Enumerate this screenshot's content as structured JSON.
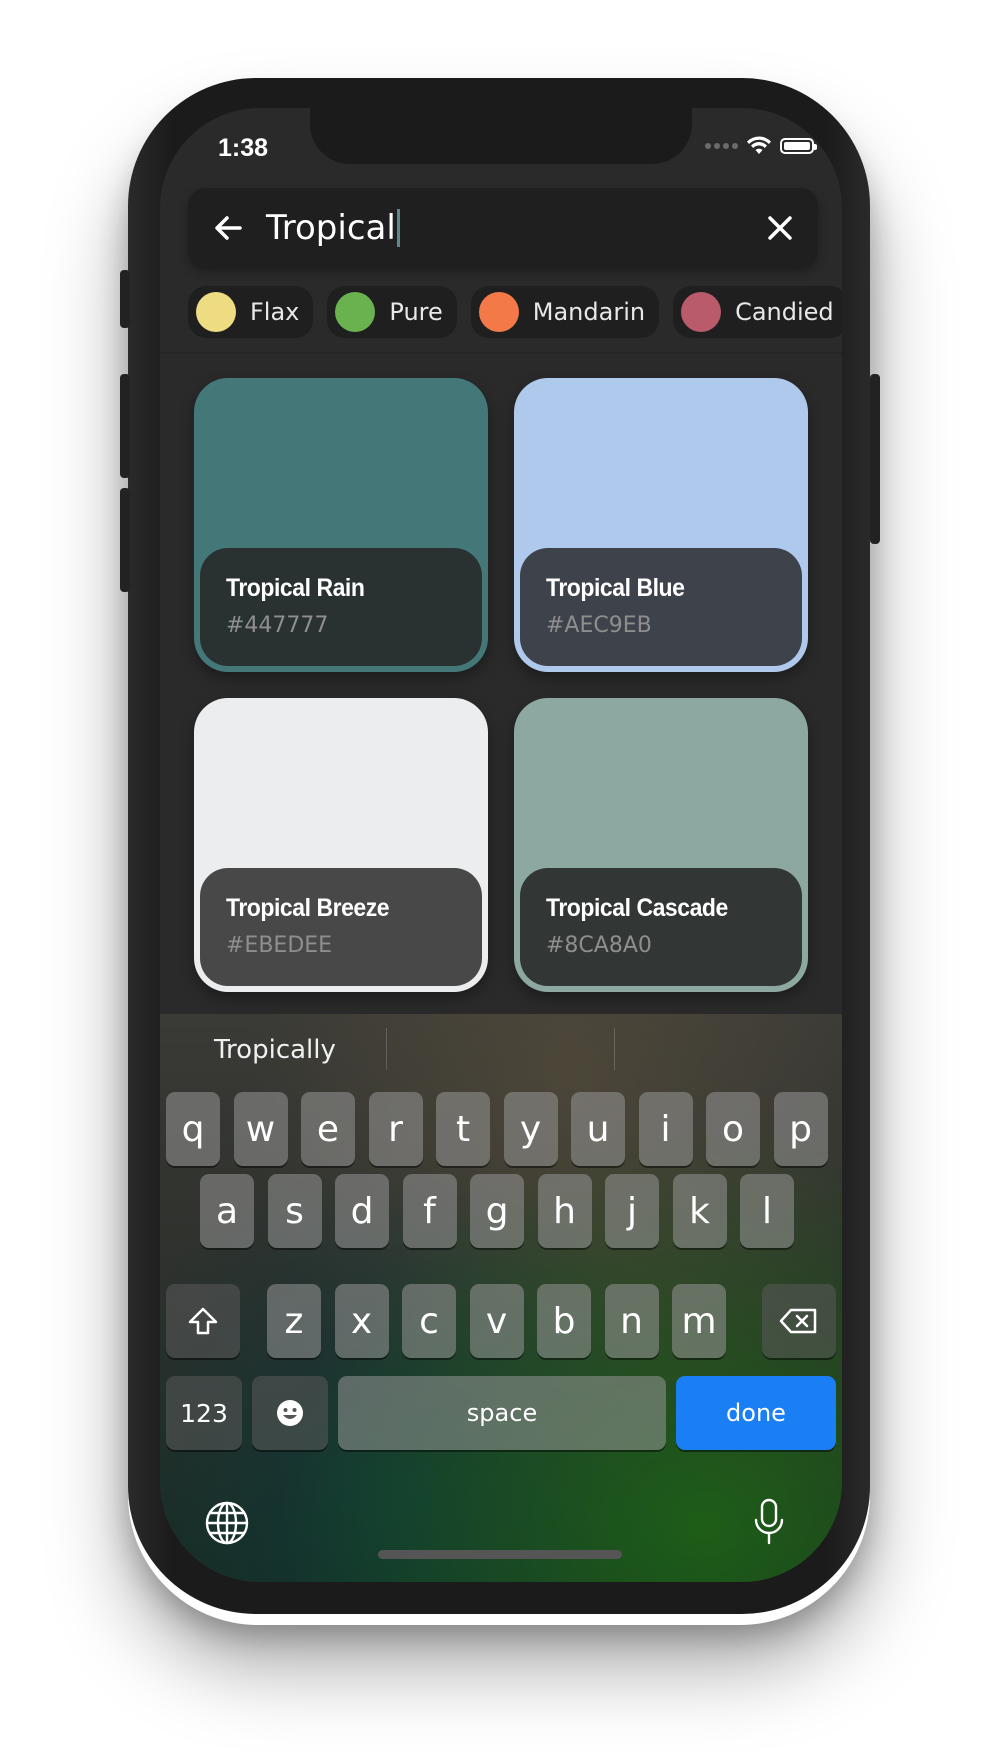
{
  "status_bar": {
    "time": "1:38"
  },
  "search": {
    "value": "Tropical"
  },
  "chips": [
    {
      "label": "Flax",
      "color": "#EEDC82"
    },
    {
      "label": "Pure",
      "color": "#6AB150"
    },
    {
      "label": "Mandarin",
      "color": "#F37A48"
    },
    {
      "label": "Candied",
      "color": "#B95B6A"
    }
  ],
  "colors": [
    {
      "name": "Tropical Rain",
      "hex": "#447777",
      "swatch": "#447777",
      "panel": "#293131"
    },
    {
      "name": "Tropical Blue",
      "hex": "#AEC9EB",
      "swatch": "#AEC9EB",
      "panel": "#3E424A"
    },
    {
      "name": "Tropical Breeze",
      "hex": "#EBEDEE",
      "swatch": "#EBEDEE",
      "panel": "#484848"
    },
    {
      "name": "Tropical Cascade",
      "hex": "#8CA8A0",
      "swatch": "#8CA8A0",
      "panel": "#323634"
    }
  ],
  "keyboard": {
    "suggestions": [
      "Tropically",
      "",
      ""
    ],
    "row1": [
      "q",
      "w",
      "e",
      "r",
      "t",
      "y",
      "u",
      "i",
      "o",
      "p"
    ],
    "row2": [
      "a",
      "s",
      "d",
      "f",
      "g",
      "h",
      "j",
      "k",
      "l"
    ],
    "row3": [
      "z",
      "x",
      "c",
      "v",
      "b",
      "n",
      "m"
    ],
    "numbers_label": "123",
    "space_label": "space",
    "done_label": "done"
  }
}
